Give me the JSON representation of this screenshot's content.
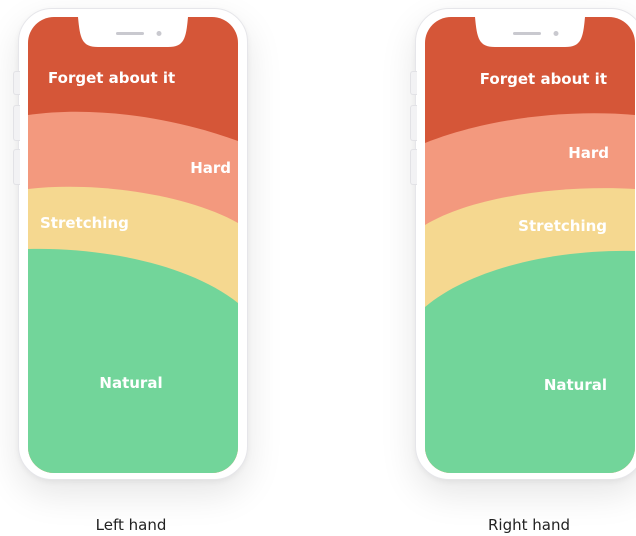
{
  "zones": {
    "forget": "Forget about it",
    "hard": "Hard",
    "stretching": "Stretching",
    "natural": "Natural"
  },
  "captions": {
    "left": "Left hand",
    "right": "Right hand"
  },
  "colors": {
    "forget": "#d55638",
    "hard": "#f3997e",
    "stretching": "#f5d890",
    "natural": "#72d59a",
    "notch": "#ffffff",
    "notch_detail": "#c9c9cf"
  }
}
